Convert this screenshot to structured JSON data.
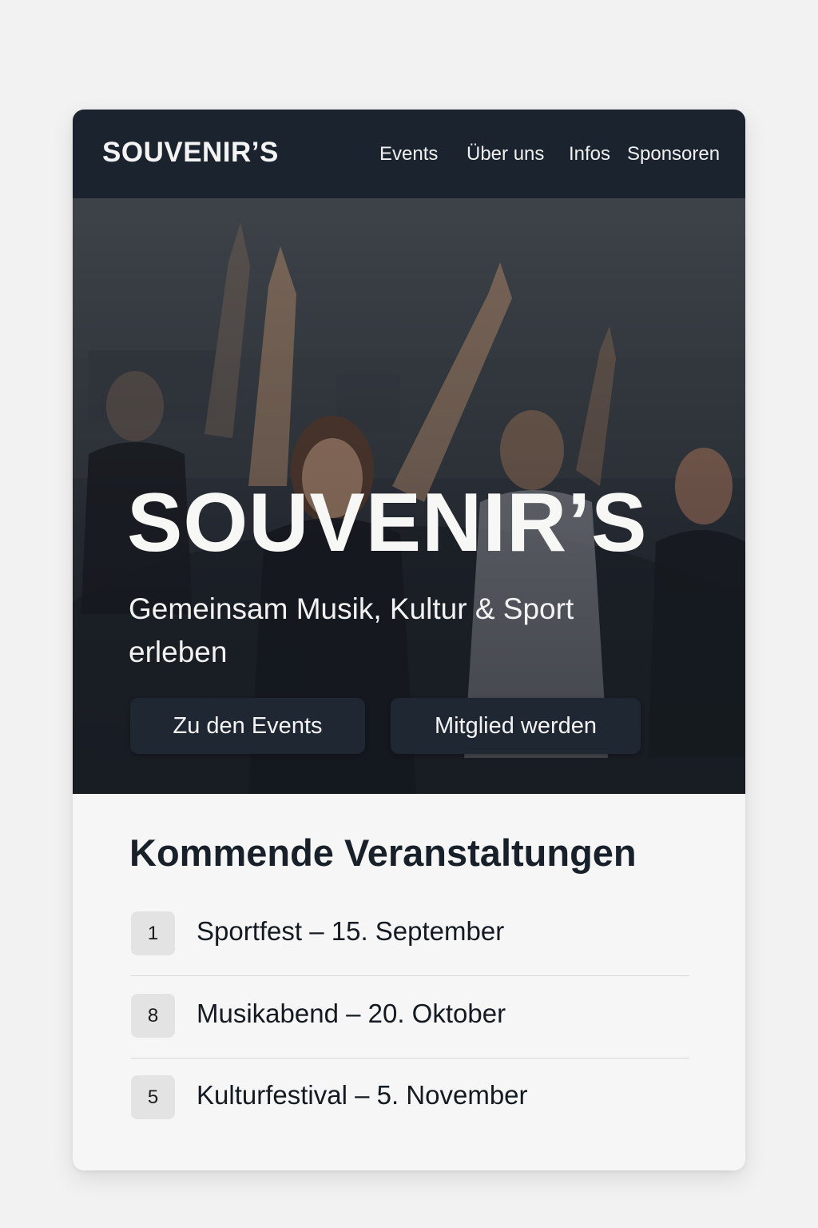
{
  "brand": "SOUVENIR’S",
  "nav": {
    "events": "Events",
    "about": "Über uns",
    "infos": "Infos",
    "sponsors": "Sponsoren"
  },
  "hero": {
    "title": "SOUVENIR’S",
    "subtitle": "Gemeinsam Musik, Kultur & Sport erleben",
    "button_events": "Zu den Events",
    "button_member": "Mitglied werden"
  },
  "events": {
    "heading": "Kommende Veranstaltungen",
    "items": [
      {
        "badge": "1",
        "label": "Sportfest – 15. September"
      },
      {
        "badge": "8",
        "label": "Musikabend – 20. Oktober"
      },
      {
        "badge": "5",
        "label": "Kulturfestival – 5. November"
      }
    ]
  },
  "colors": {
    "navbar": "#1b232e",
    "button": "#1e2732",
    "page_background": "#f2f2f2",
    "card_background": "#f6f6f6",
    "badge": "#e3e3e3",
    "heading_text": "#18202a"
  }
}
